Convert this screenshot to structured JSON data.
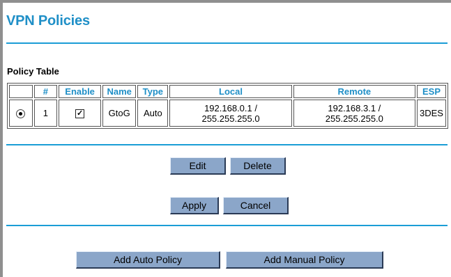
{
  "page": {
    "title": "VPN Policies"
  },
  "policy_table": {
    "label": "Policy Table",
    "columns": [
      "",
      "#",
      "Enable",
      "Name",
      "Type",
      "Local",
      "Remote",
      "ESP"
    ],
    "rows": [
      {
        "selected": true,
        "number": "1",
        "enabled": true,
        "name": "GtoG",
        "type": "Auto",
        "local_ip": "192.168.0.1 /",
        "local_mask": "255.255.255.0",
        "remote_ip": "192.168.3.1 /",
        "remote_mask": "255.255.255.0",
        "esp": "3DES"
      }
    ]
  },
  "buttons": {
    "edit": "Edit",
    "delete": "Delete",
    "apply": "Apply",
    "cancel": "Cancel",
    "add_auto": "Add Auto Policy",
    "add_manual": "Add Manual Policy"
  },
  "colors": {
    "title": "#1f8fc7",
    "rule": "#1a9dd6",
    "button": "#8ba6c9"
  },
  "icons": {
    "radio": "radio-selected-icon",
    "checkbox": "checkbox-checked-icon"
  }
}
